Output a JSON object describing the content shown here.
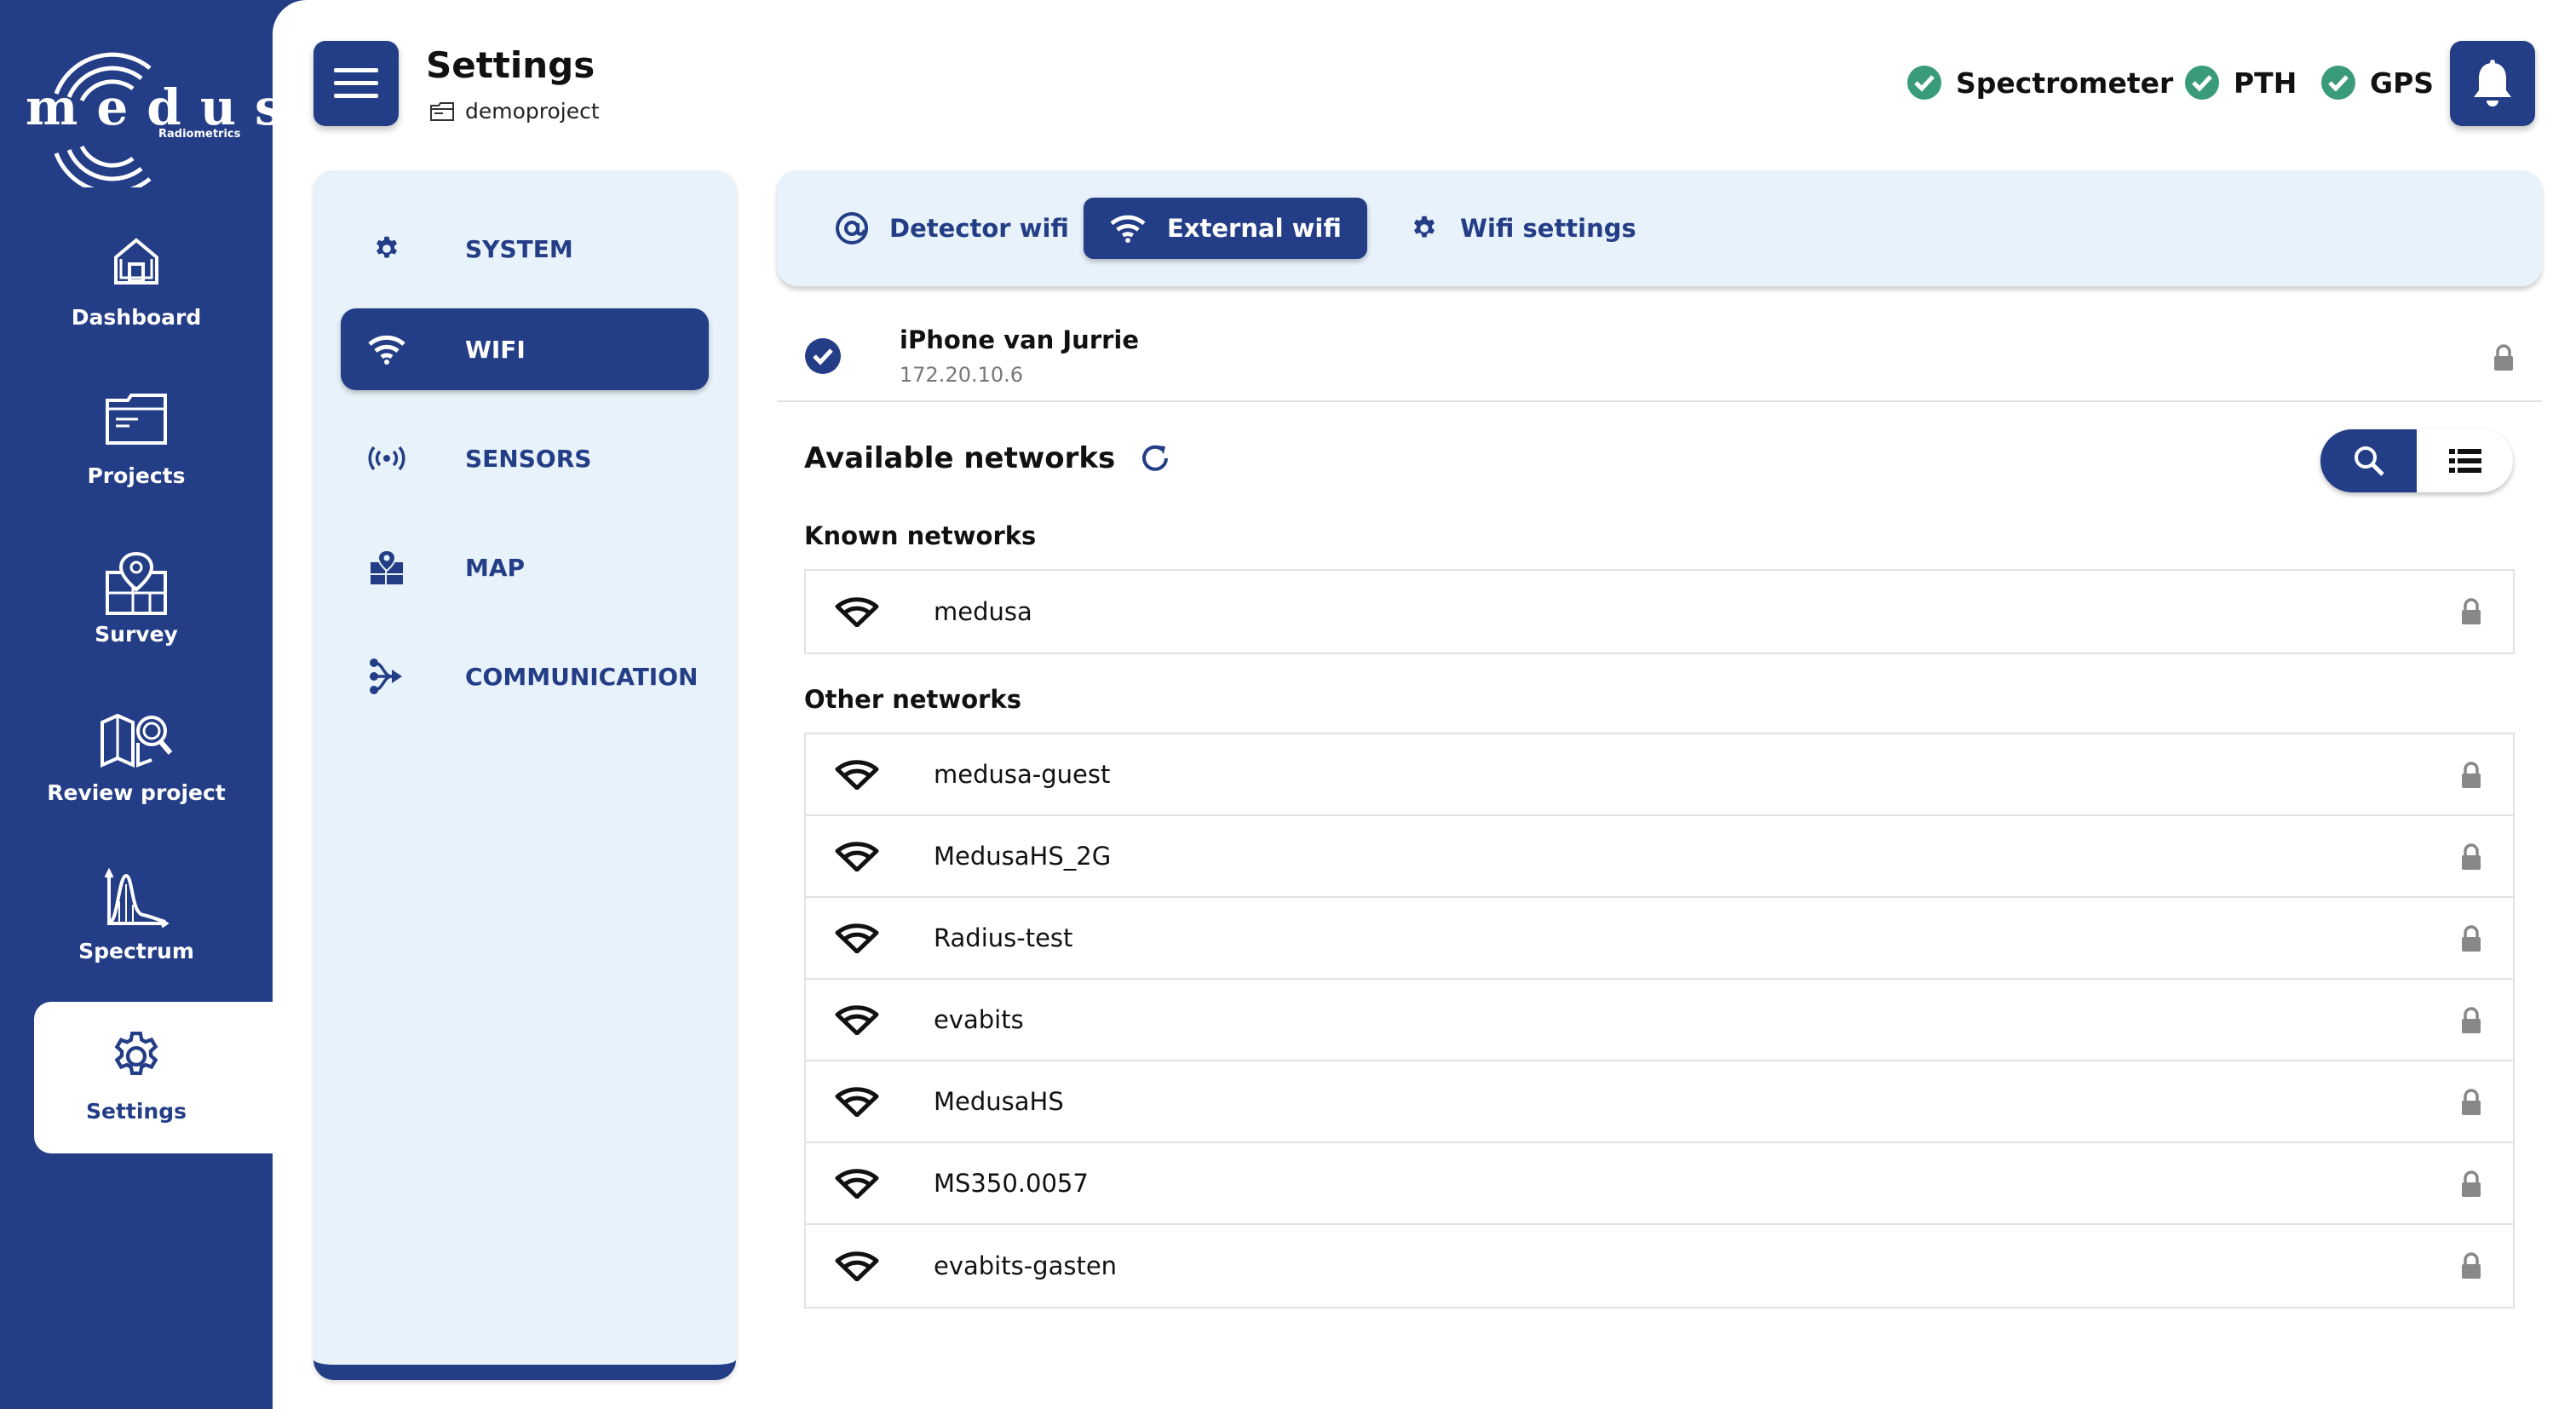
{
  "brand": {
    "name": "medusa",
    "sub": "Radiometrics"
  },
  "rail": [
    {
      "label": "Dashboard",
      "icon": "home-icon"
    },
    {
      "label": "Projects",
      "icon": "folder-icon"
    },
    {
      "label": "Survey",
      "icon": "map-pin-icon"
    },
    {
      "label": "Review project",
      "icon": "map-search-icon"
    },
    {
      "label": "Spectrum",
      "icon": "spectrum-chart-icon"
    },
    {
      "label": "Settings",
      "icon": "gear-icon",
      "active": true
    }
  ],
  "header": {
    "title": "Settings",
    "project": "demoproject",
    "status": [
      "Spectrometer",
      "PTH",
      "GPS"
    ]
  },
  "nav": [
    {
      "label": "SYSTEM",
      "icon": "gear-icon"
    },
    {
      "label": "WIFI",
      "icon": "wifi-icon",
      "active": true
    },
    {
      "label": "SENSORS",
      "icon": "broadcast-icon"
    },
    {
      "label": "MAP",
      "icon": "map-icon"
    },
    {
      "label": "COMMUNICATION",
      "icon": "share-icon"
    }
  ],
  "tabs": [
    {
      "label": "Detector wifi",
      "icon": "at-icon"
    },
    {
      "label": "External wifi",
      "icon": "wifi-icon",
      "active": true
    },
    {
      "label": "Wifi settings",
      "icon": "gear-icon"
    }
  ],
  "connected": {
    "name": "iPhone van Jurrie",
    "ip": "172.20.10.6"
  },
  "available": {
    "title": "Available networks",
    "known_title": "Known networks",
    "known": [
      "medusa"
    ],
    "other_title": "Other networks",
    "other": [
      "medusa-guest",
      "MedusaHS_2G",
      "Radius-test",
      "evabits",
      "MedusaHS",
      "MS350.0057",
      "evabits-gasten"
    ]
  },
  "colors": {
    "primary": "#233d86",
    "panel": "#e8f2fa",
    "ok": "#3a9b7a",
    "lock": "#888888"
  }
}
